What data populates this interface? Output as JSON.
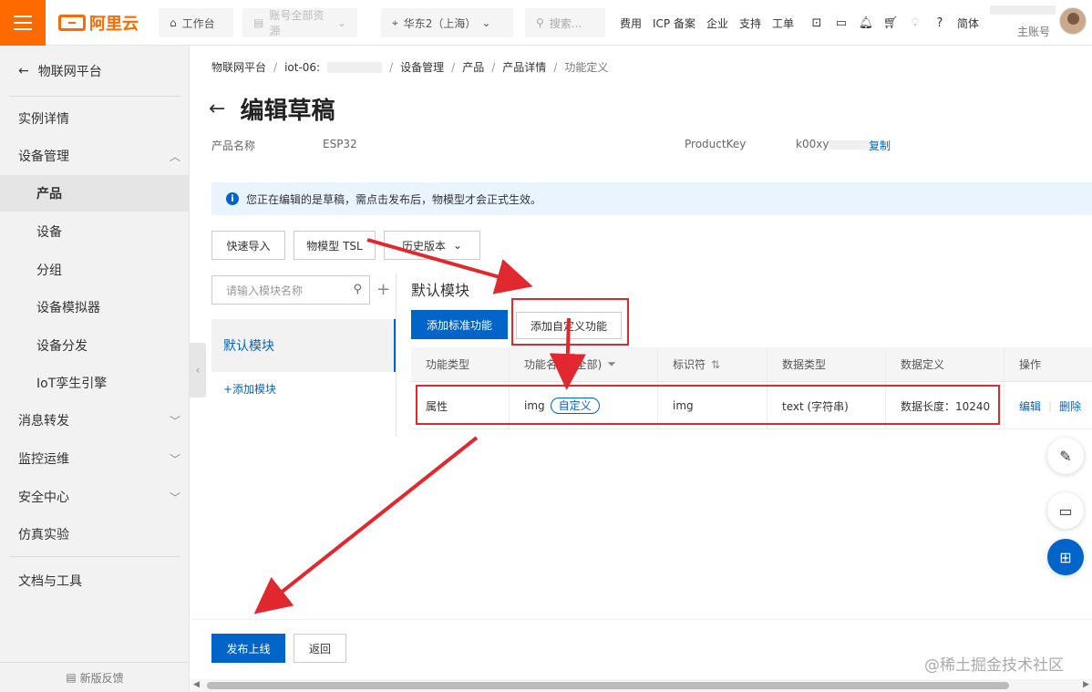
{
  "topbar": {
    "logo": "阿里云",
    "workbench": "工作台",
    "resources": "账号全部资源",
    "region": "华东2（上海）",
    "search_placeholder": "搜索...",
    "links": [
      "费用",
      "ICP 备案",
      "企业",
      "支持",
      "工单"
    ],
    "lang": "简体",
    "account_label": "主账号"
  },
  "sidebar": {
    "back_label": "物联网平台",
    "items": [
      {
        "label": "实例详情",
        "level": 1
      },
      {
        "label": "设备管理",
        "level": 1,
        "expanded": true
      },
      {
        "label": "产品",
        "level": 2,
        "active": true
      },
      {
        "label": "设备",
        "level": 2
      },
      {
        "label": "分组",
        "level": 2
      },
      {
        "label": "设备模拟器",
        "level": 2
      },
      {
        "label": "设备分发",
        "level": 2
      },
      {
        "label": "IoT孪生引擎",
        "level": 2
      },
      {
        "label": "消息转发",
        "level": 1,
        "collapsed": true
      },
      {
        "label": "监控运维",
        "level": 1,
        "collapsed": true
      },
      {
        "label": "安全中心",
        "level": 1,
        "collapsed": true
      },
      {
        "label": "仿真实验",
        "level": 1
      },
      {
        "label": "文档与工具",
        "level": 1
      }
    ],
    "feedback": "新版反馈"
  },
  "breadcrumb": [
    "物联网平台",
    "iot-06:",
    "设备管理",
    "产品",
    "产品详情",
    "功能定义"
  ],
  "page": {
    "title": "编辑草稿",
    "product_name_label": "产品名称",
    "product_name": "ESP32",
    "product_key_label": "ProductKey",
    "product_key": "k00xy",
    "copy": "复制"
  },
  "notice": "您正在编辑的是草稿，需点击发布后，物模型才会正式生效。",
  "toolbar": {
    "quick_import": "快速导入",
    "tsl": "物模型 TSL",
    "history": "历史版本"
  },
  "modules": {
    "search_placeholder": "请输入模块名称",
    "default": "默认模块",
    "add": "+添加模块"
  },
  "section": {
    "title": "默认模块",
    "add_standard": "添加标准功能",
    "add_custom": "添加自定义功能"
  },
  "table": {
    "headers": [
      "功能类型",
      "功能名称 (全部)",
      "标识符",
      "数据类型",
      "数据定义",
      "操作"
    ],
    "rows": [
      {
        "type": "属性",
        "name": "img",
        "tag": "自定义",
        "identifier": "img",
        "data_type": "text (字符串)",
        "definition": "数据长度：10240",
        "edit": "编辑",
        "delete": "删除"
      }
    ]
  },
  "footer": {
    "publish": "发布上线",
    "back": "返回"
  },
  "watermark": "@稀土掘金技术社区",
  "colors": {
    "brand": "#ff6a00",
    "primary": "#0064c8",
    "annotation": "#e0282e"
  }
}
